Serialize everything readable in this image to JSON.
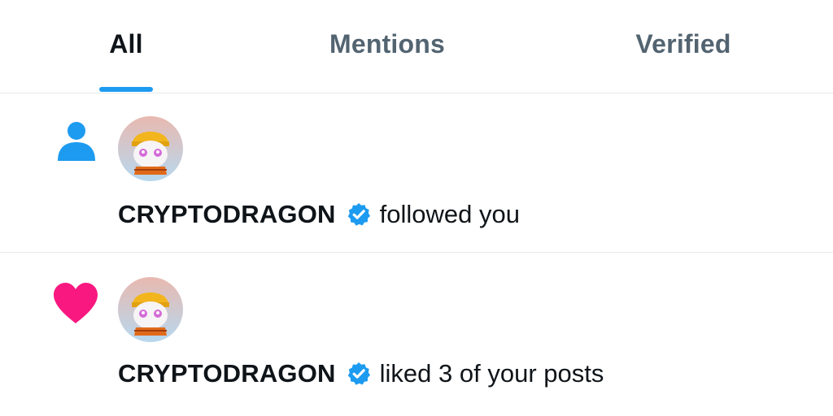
{
  "tabs": [
    {
      "label": "All",
      "active": true
    },
    {
      "label": "Mentions",
      "active": false
    },
    {
      "label": "Verified",
      "active": false
    }
  ],
  "notifications": [
    {
      "type_icon": "person-icon",
      "username": "CRYPTODRAGON",
      "verified": true,
      "action": "followed you"
    },
    {
      "type_icon": "heart-icon",
      "username": "CRYPTODRAGON",
      "verified": true,
      "action": "liked 3 of your posts"
    }
  ],
  "colors": {
    "accent": "#1d9bf0",
    "like": "#f91880",
    "text": "#0f1419",
    "muted": "#536471",
    "divider": "#e7e9ea"
  }
}
